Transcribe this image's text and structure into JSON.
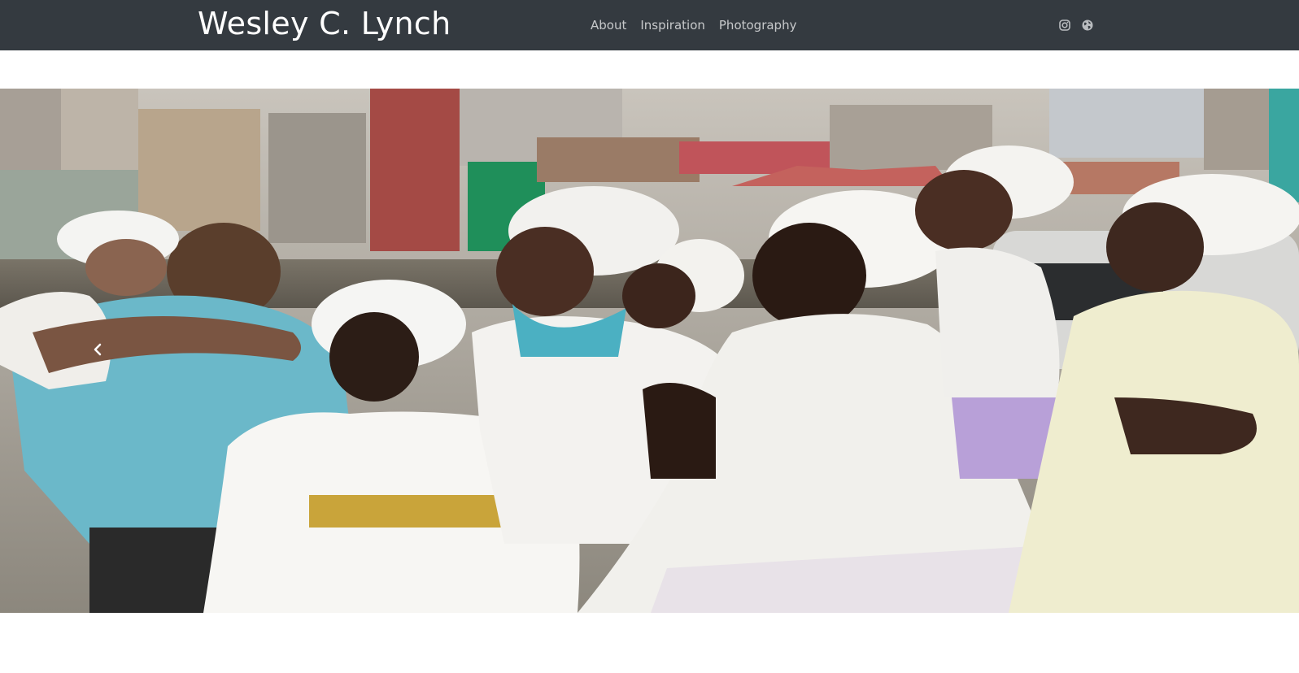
{
  "navbar": {
    "brand": "Wesley C. Lynch",
    "links": [
      {
        "label": "About"
      },
      {
        "label": "Inspiration"
      },
      {
        "label": "Photography"
      }
    ],
    "social_icons": [
      "instagram-icon",
      "globe-icon"
    ]
  },
  "carousel": {
    "image_description_icon": "photo",
    "controls": {
      "prev_icon": "chevron-left-icon"
    }
  },
  "colors": {
    "navbar_bg": "#343a40",
    "brand_text": "#ffffff",
    "nav_text": "#c8cacc"
  }
}
